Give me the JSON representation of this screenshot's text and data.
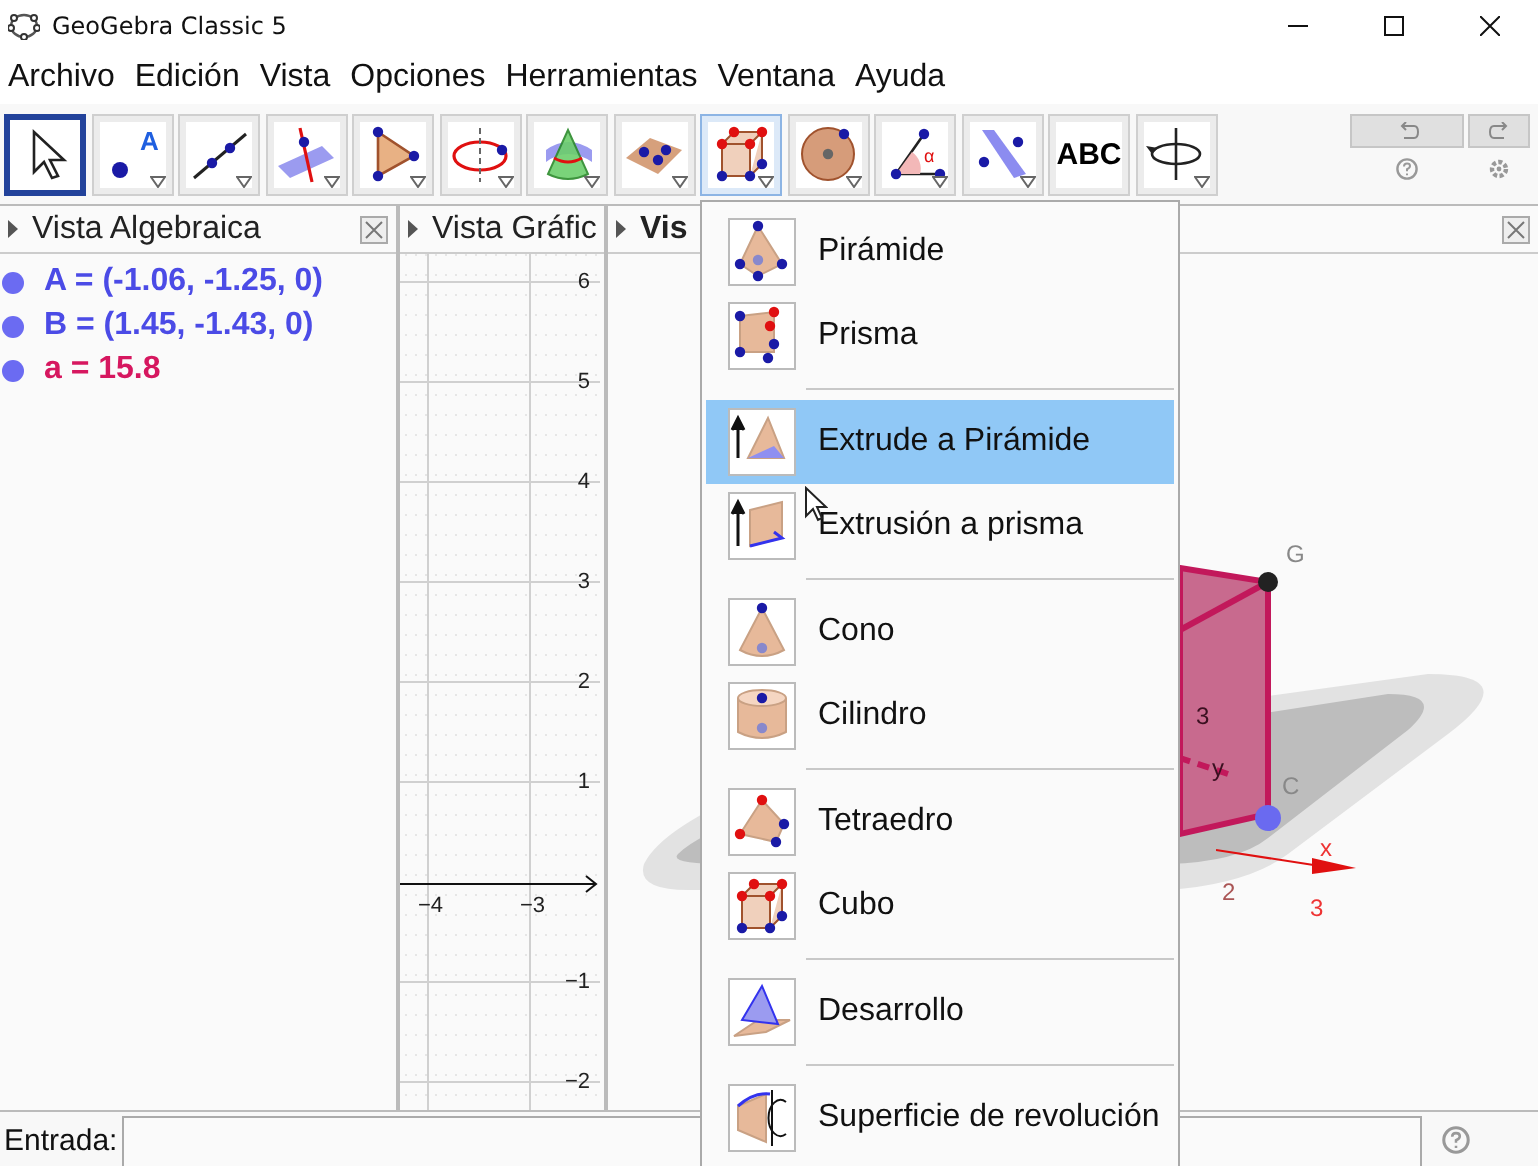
{
  "window": {
    "title": "GeoGebra Classic 5"
  },
  "menu_bar": [
    "Archivo",
    "Edición",
    "Vista",
    "Opciones",
    "Herramientas",
    "Ventana",
    "Ayuda"
  ],
  "toolbar": {
    "tools": [
      {
        "kind": "move",
        "selected": true,
        "open": false,
        "menu": false
      },
      {
        "kind": "point",
        "selected": false,
        "open": false,
        "menu": true,
        "label": "A"
      },
      {
        "kind": "line",
        "selected": false,
        "open": false,
        "menu": true
      },
      {
        "kind": "perpendicular",
        "selected": false,
        "open": false,
        "menu": true
      },
      {
        "kind": "polygon",
        "selected": false,
        "open": false,
        "menu": true
      },
      {
        "kind": "circle",
        "selected": false,
        "open": false,
        "menu": true
      },
      {
        "kind": "intersect",
        "selected": false,
        "open": false,
        "menu": true
      },
      {
        "kind": "plane",
        "selected": false,
        "open": false,
        "menu": true
      },
      {
        "kind": "cube",
        "selected": false,
        "open": true,
        "menu": true
      },
      {
        "kind": "sphere",
        "selected": false,
        "open": false,
        "menu": true
      },
      {
        "kind": "angle",
        "selected": false,
        "open": false,
        "menu": true,
        "label": "α"
      },
      {
        "kind": "reflect",
        "selected": false,
        "open": false,
        "menu": true
      },
      {
        "kind": "text",
        "selected": false,
        "open": false,
        "menu": false,
        "label": "ABC"
      },
      {
        "kind": "rotate",
        "selected": false,
        "open": false,
        "menu": true
      }
    ]
  },
  "algebra_view": {
    "title": "Vista Algebraica",
    "items": [
      {
        "text": "A = (-1.06, -1.25, 0)",
        "color": "#4b4be6"
      },
      {
        "text": "B = (1.45, -1.43, 0)",
        "color": "#4b4be6"
      },
      {
        "text": "a = 15.8",
        "color": "#d6175f"
      }
    ]
  },
  "graphics_view": {
    "title": "Vista Gráfic",
    "y_labels": [
      "6",
      "5",
      "4",
      "3",
      "2",
      "1",
      "−1",
      "−2"
    ],
    "x_labels": [
      "−4",
      "−3"
    ]
  },
  "view_3d": {
    "title": "Vis",
    "labels": [
      "G",
      "3",
      "y",
      "C",
      "x",
      "2",
      "3"
    ]
  },
  "tool_menu": {
    "groups": [
      [
        {
          "kind": "pyramid",
          "label": "Pirámide",
          "selected": false
        },
        {
          "kind": "prism",
          "label": "Prisma",
          "selected": false
        }
      ],
      [
        {
          "kind": "extrude_pyramid",
          "label": "Extrude a Pirámide",
          "selected": true
        },
        {
          "kind": "extrude_prism",
          "label": "Extrusión a prisma",
          "selected": false
        }
      ],
      [
        {
          "kind": "cone",
          "label": "Cono",
          "selected": false
        },
        {
          "kind": "cylinder",
          "label": "Cilindro",
          "selected": false
        }
      ],
      [
        {
          "kind": "tetrahedron",
          "label": "Tetraedro",
          "selected": false
        },
        {
          "kind": "cube",
          "label": "Cubo",
          "selected": false
        }
      ],
      [
        {
          "kind": "net",
          "label": "Desarrollo",
          "selected": false
        }
      ],
      [
        {
          "kind": "revolution",
          "label": "Superficie de revolución",
          "selected": false
        }
      ]
    ]
  },
  "input_bar": {
    "label": "Entrada:"
  }
}
